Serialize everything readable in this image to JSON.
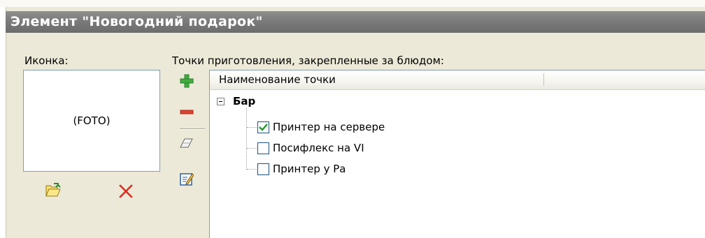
{
  "window": {
    "title": "Элемент \"Новогодний подарок\""
  },
  "icon_section": {
    "label": "Иконка:",
    "placeholder_text": "(FOTO)",
    "open_icon": "folder-open-icon",
    "delete_icon": "delete-x-icon"
  },
  "points_section": {
    "label": "Точки приготовления, закрепленные за блюдом:",
    "toolbar": [
      {
        "name": "add",
        "icon": "plus-icon"
      },
      {
        "name": "remove",
        "icon": "minus-icon"
      },
      {
        "name": "clear",
        "icon": "eraser-icon"
      },
      {
        "name": "edit",
        "icon": "edit-icon"
      }
    ],
    "grid": {
      "column_header": "Наименование точки",
      "group": {
        "name": "Бар",
        "expanded": true,
        "items": [
          {
            "label": "Принтер на сервере",
            "checked": true
          },
          {
            "label": "Посифлекс на VI",
            "checked": false
          },
          {
            "label": "Принтер у Ра",
            "checked": false
          }
        ]
      }
    }
  },
  "colors": {
    "title_bar": "#7b7b7b",
    "panel_background": "#ece9d8",
    "border": "#7f9db9",
    "add_green": "#2e9e2e",
    "remove_red": "#d92b1c",
    "checkmark_green": "#1f9a24"
  }
}
